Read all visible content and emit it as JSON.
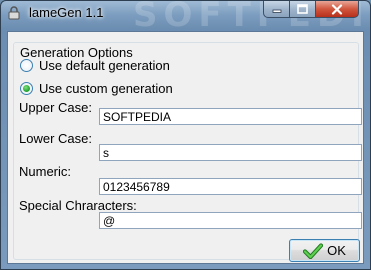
{
  "window": {
    "title": "lameGen 1.1",
    "watermark": "SOFTPEDIA",
    "icons": {
      "app": "lock-icon",
      "minimize": "minimize-icon",
      "maximize": "maximize-icon",
      "close": "close-icon"
    }
  },
  "group": {
    "title": "Generation Options",
    "radios": [
      {
        "label": "Use default generation",
        "checked": false
      },
      {
        "label": "Use custom generation",
        "checked": true
      }
    ]
  },
  "fields": [
    {
      "label": "Upper Case:",
      "value": "SOFTPEDIA"
    },
    {
      "label": "Lower Case:",
      "value": "s"
    },
    {
      "label": "Numeric:",
      "value": "0123456789"
    },
    {
      "label": "Special Chraracters:",
      "value": "@"
    }
  ],
  "ok_button": {
    "label": "OK",
    "icon": "checkmark-icon"
  },
  "colors": {
    "accent": "#3c7fb1",
    "check_green": "#2a9d2a",
    "close_red": "#c7442a"
  }
}
